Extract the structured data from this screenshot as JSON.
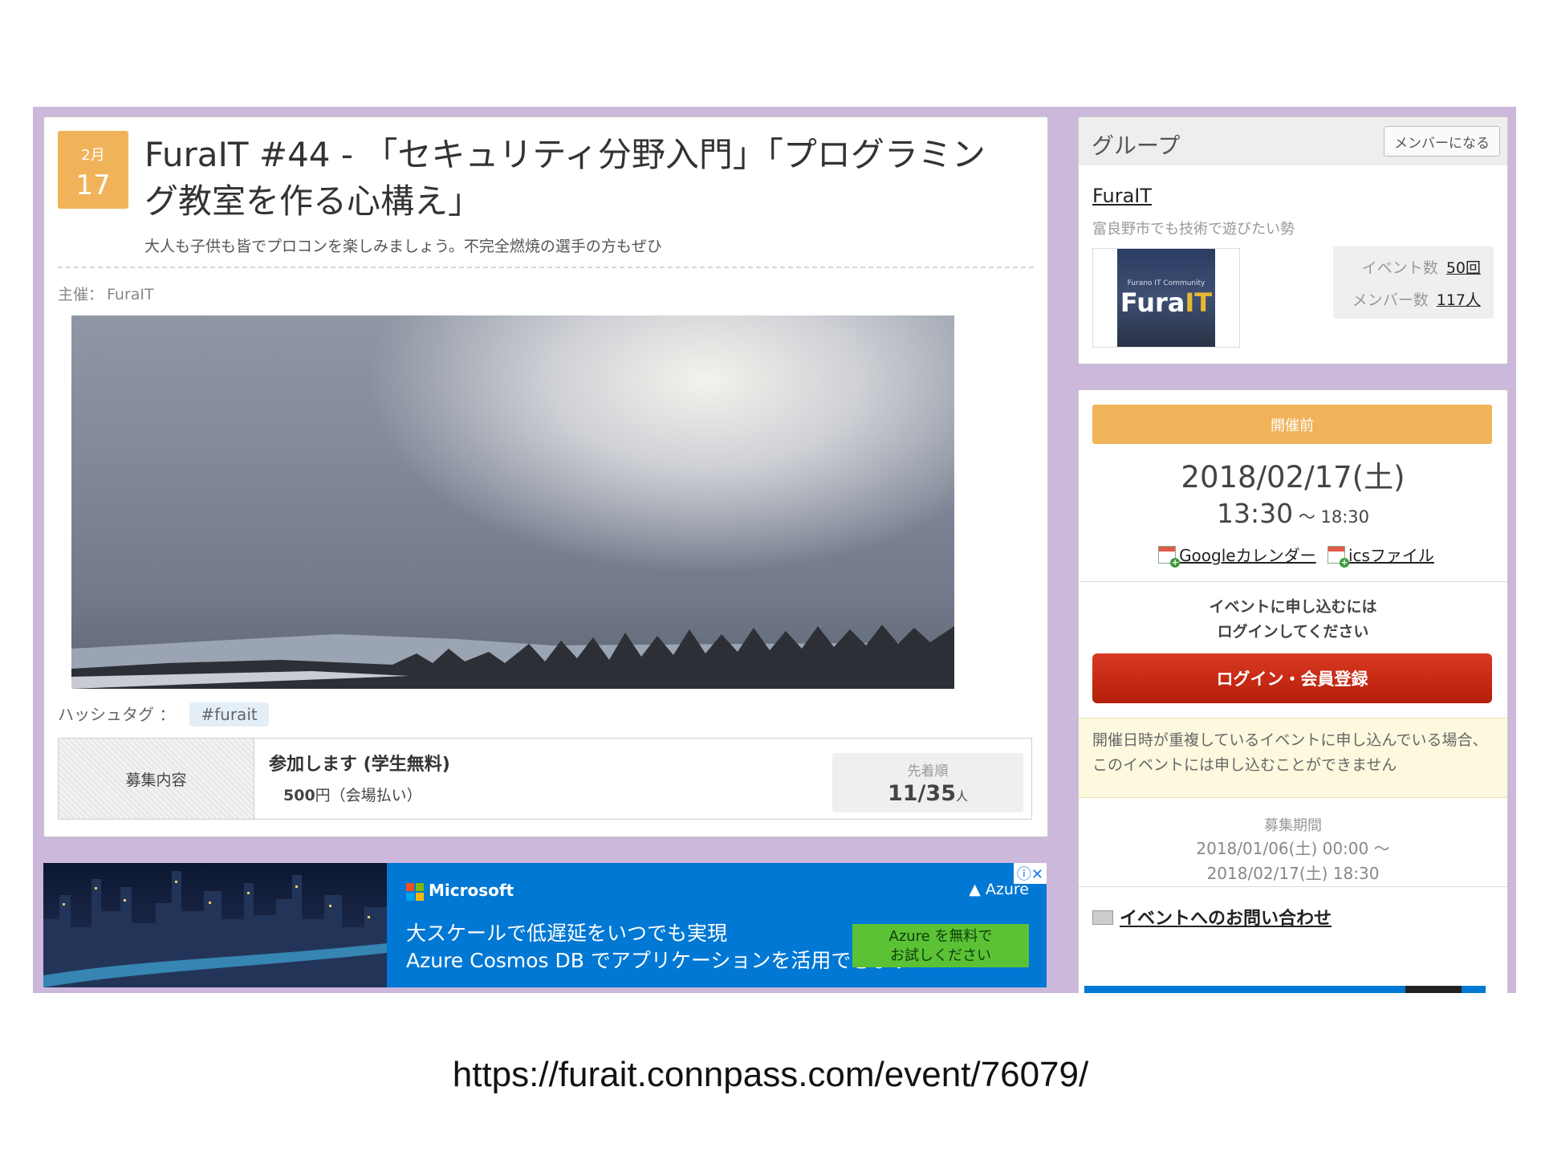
{
  "event": {
    "date_badge": {
      "month": "2月",
      "day": "17"
    },
    "title": "FuraIT #44 - 「セキュリティ分野入門」「プログラミング教室を作る心構え」",
    "catch": "大人も子供も皆でプロコンを楽しみましょう。不完全燃焼の選手の方もぜひ",
    "organizer_label": "主催：",
    "organizer": "FuraIT",
    "hashtag_label": "ハッシュタグ ：",
    "hashtag": "#furait",
    "ticket": {
      "header": "募集内容",
      "name": "参加します (学生無料)",
      "price": "500",
      "price_unit": "円（会場払い）",
      "capacity_label": "先着順",
      "capacity": "11/35",
      "capacity_unit": "人"
    }
  },
  "ad": {
    "brand": "Microsoft",
    "product": "Azure",
    "line1": "大スケールで低遅延をいつでも実現",
    "line2": "Azure Cosmos DB でアプリケーションを活用できます",
    "cta": "Azure を無料で\nお試しください",
    "ms_colors": [
      "#f25022",
      "#7fba00",
      "#00a4ef",
      "#ffb900"
    ]
  },
  "group": {
    "heading": "グループ",
    "join_button": "メンバーになる",
    "name": "FuraIT",
    "description": "富良野市でも技術で遊びたい勢",
    "logo_sub": "Furano IT Community",
    "logo_main_a": "Fura",
    "logo_main_b": "IT",
    "event_count_label": "イベント数",
    "event_count": "50回",
    "member_count_label": "メンバー数",
    "member_count": "117人"
  },
  "info": {
    "status": "開催前",
    "date": "2018/02/17(土)",
    "start_time": "13:30",
    "time_sep": " ～ ",
    "end_time": "18:30",
    "google_calendar": "Googleカレンダー",
    "ics_file": "icsファイル",
    "login_msg_1": "イベントに申し込むには",
    "login_msg_2": "ログインしてください",
    "login_button": "ログイン・会員登録",
    "warning": "開催日時が重複しているイベントに申し込んでいる場合、このイベントには申し込むことができません",
    "period_label": "募集期間",
    "period_start": "2018/01/06(土) 00:00 ～",
    "period_end": "2018/02/17(土) 18:30",
    "contact": "イベントへのお問い合わせ"
  },
  "url": "https://furait.connpass.com/event/76079/",
  "colors": {
    "frame": "#ccb8db",
    "accent": "#f0b35a",
    "login": "#c62a14",
    "ad_blue": "#0078d4"
  }
}
